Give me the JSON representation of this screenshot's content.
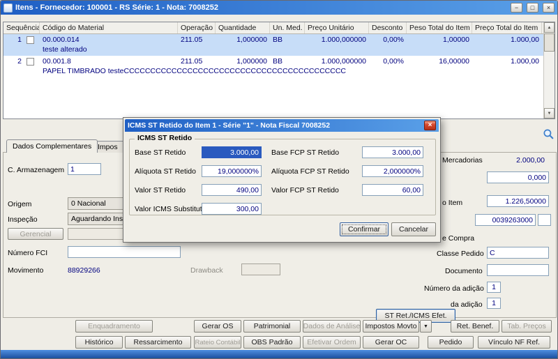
{
  "colors": {
    "titlebar_start": "#1F5FC4",
    "titlebar_end": "#5AA0E8",
    "selected_row": "#C7DDF8",
    "value_text": "#00007F",
    "status_bar": "#1D4F9E",
    "dialog_close_red": "#C13020"
  },
  "icons": {
    "minimize": "−",
    "maximize": "□",
    "close": "×",
    "dialog_close": "×",
    "dropdown_arrow": "▼",
    "scroll_up": "▲",
    "scroll_down": "▼"
  },
  "window": {
    "title": "Itens - Fornecedor: 100001 - RS Série: 1 - Nota: 7008252"
  },
  "grid": {
    "columns": [
      "Sequência",
      "Código do Material",
      "Operação",
      "Quantidade",
      "Un. Med.",
      "Preço Unitário",
      "Desconto",
      "Peso Total do Item",
      "Preço Total do Item"
    ],
    "rows": [
      {
        "seq": "1",
        "codigo": "00.000.014",
        "descricao": "teste alterado",
        "operacao": "211.05",
        "quantidade": "1,000000",
        "un_med": "BB",
        "preco_unitario": "1.000,000000",
        "desconto": "0,00%",
        "peso_total": "1,00000",
        "preco_total": "1.000,00"
      },
      {
        "seq": "2",
        "codigo": "00.001.8",
        "descricao": "PAPEL TIMBRADO testeCCCCCCCCCCCCCCCCCCCCCCCCCCCCCCCCCCCCCCCCCC",
        "operacao": "211.05",
        "quantidade": "1,000000",
        "un_med": "BB",
        "preco_unitario": "1.000,000000",
        "desconto": "0,00%",
        "peso_total": "16,00000",
        "preco_total": "1.000,00"
      }
    ]
  },
  "tabs": {
    "tab1": "Dados Complementares",
    "tab2": "Impos"
  },
  "form": {
    "armazenagem_label": "C. Armazenagem",
    "armazenagem_value": "1",
    "origem_label": "Origem",
    "origem_value": "0 Nacional",
    "inspecao_label": "Inspeção",
    "inspecao_value": "Aguardando Inspe",
    "gerencial_button": "Gerencial",
    "numero_fci_label": "Número FCI",
    "movimento_label": "Movimento",
    "movimento_value": "88929266",
    "drawback_label": "Drawback",
    "mercadorias_label": "Mercadorias",
    "mercadorias_value": "2.000,00",
    "valor2_value": "0,000",
    "item_label": "o Item",
    "item_value": "1.226,50000",
    "codigo_value": "0039263000",
    "compra_label": "e Compra",
    "classe_pedido_label": "Classe Pedido",
    "classe_pedido_value": "C",
    "documento_label": "Documento",
    "numero_adicao_label": "Número da adição",
    "numero_adicao_value": "1",
    "seq_adicao_label": "da adição",
    "seq_adicao_value": "1",
    "st_ret_button": "ST Ret./ICMS Efet."
  },
  "dialog": {
    "title": "ICMS ST Retido do Item 1 - Série \"1\" - Nota Fiscal 7008252",
    "group_title": "ICMS ST Retido",
    "left_fields": [
      {
        "label": "Base ST Retido",
        "value": "3.000,00"
      },
      {
        "label": "Alíquota ST Retido",
        "value": "19,000000%"
      },
      {
        "label": "Valor ST Retido",
        "value": "490,00"
      },
      {
        "label": "Valor ICMS Substituto",
        "value": "300,00"
      }
    ],
    "right_fields": [
      {
        "label": "Base FCP ST Retido",
        "value": "3.000,00"
      },
      {
        "label": "Alíquota FCP ST Retido",
        "value": "2,000000%"
      },
      {
        "label": "Valor FCP ST Retido",
        "value": "60,00"
      }
    ],
    "confirm_button": "Confirmar",
    "cancel_button": "Cancelar"
  },
  "toolbar": {
    "row1": [
      "Enquadramento",
      "Gerar OS",
      "Patrimonial",
      "Dados de Análise",
      "Impostos Movto",
      "Ret. Benef.",
      "Tab. Preços"
    ],
    "row2": [
      "Histórico",
      "Ressarcimento",
      "Rateio Contábil",
      "OBS Padrão",
      "Efetivar Ordem",
      "Gerar OC",
      "Pedido",
      "Vínculo NF Ref."
    ]
  }
}
